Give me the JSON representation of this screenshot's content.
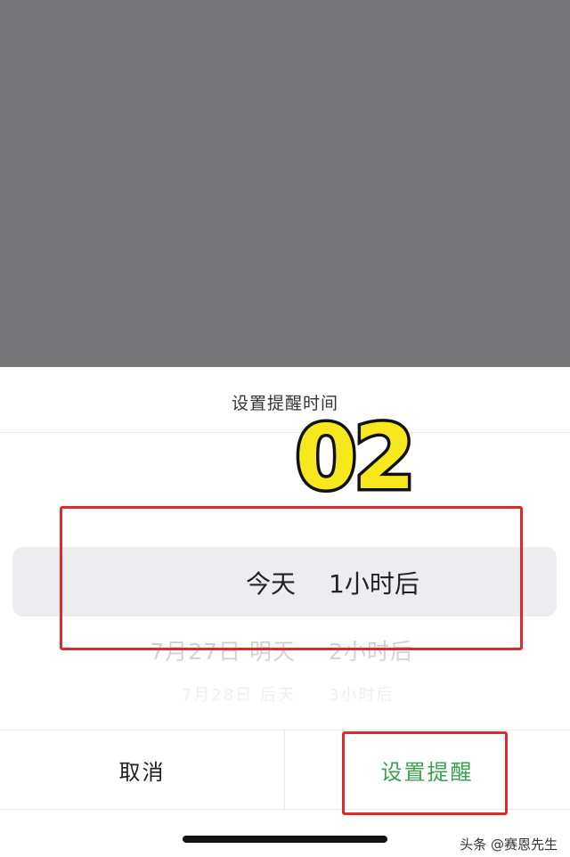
{
  "sheet": {
    "title": "设置提醒时间",
    "step_badge": "02"
  },
  "picker": {
    "selected": {
      "date": "今天",
      "time": "1小时后"
    },
    "next": {
      "date": "7月27日 明天",
      "time": "2小时后"
    },
    "next2": {
      "date": "7月28日 后天",
      "time": "3小时后"
    }
  },
  "actions": {
    "cancel_label": "取消",
    "confirm_label": "设置提醒"
  },
  "watermark": "头条 @赛恩先生",
  "colors": {
    "overlay": "#757578",
    "confirm_text": "#3aa24f",
    "highlight_box": "#e02a2a",
    "badge_fill": "#f7e81d"
  }
}
